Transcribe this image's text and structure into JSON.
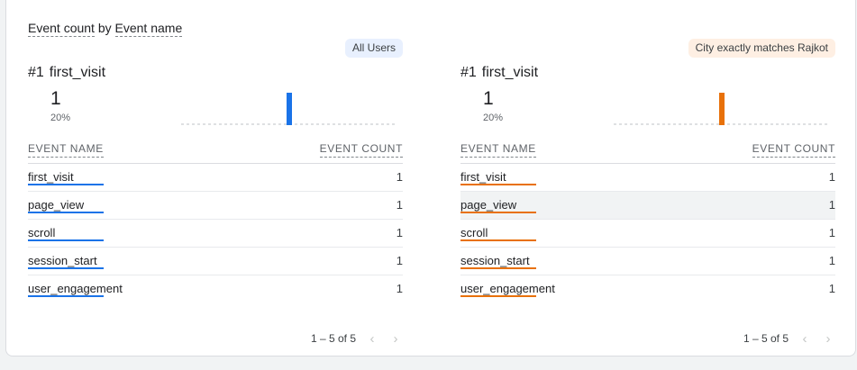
{
  "card": {
    "title_metric": "Event count",
    "title_by": "by",
    "title_dimension": "Event name"
  },
  "panels": [
    {
      "segment": "All Users",
      "rank": "#1",
      "top_event": "first_visit",
      "value": "1",
      "percent": "20%",
      "accent": "#1a73e8",
      "sparkline_bar_fraction": 0.5,
      "headers": {
        "name": "EVENT NAME",
        "count": "EVENT COUNT"
      },
      "rows": [
        {
          "name": "first_visit",
          "count": "1"
        },
        {
          "name": "page_view",
          "count": "1"
        },
        {
          "name": "scroll",
          "count": "1"
        },
        {
          "name": "session_start",
          "count": "1"
        },
        {
          "name": "user_engagement",
          "count": "1"
        }
      ],
      "pagination": "1 – 5 of 5"
    },
    {
      "segment": "City exactly matches Rajkot",
      "rank": "#1",
      "top_event": "first_visit",
      "value": "1",
      "percent": "20%",
      "accent": "#e8710a",
      "sparkline_bar_fraction": 0.5,
      "headers": {
        "name": "EVENT NAME",
        "count": "EVENT COUNT"
      },
      "rows": [
        {
          "name": "first_visit",
          "count": "1"
        },
        {
          "name": "page_view",
          "count": "1"
        },
        {
          "name": "scroll",
          "count": "1"
        },
        {
          "name": "session_start",
          "count": "1"
        },
        {
          "name": "user_engagement",
          "count": "1"
        }
      ],
      "pagination": "1 – 5 of 5"
    }
  ],
  "icons": {
    "prev": "chevron-left-icon",
    "next": "chevron-right-icon"
  }
}
